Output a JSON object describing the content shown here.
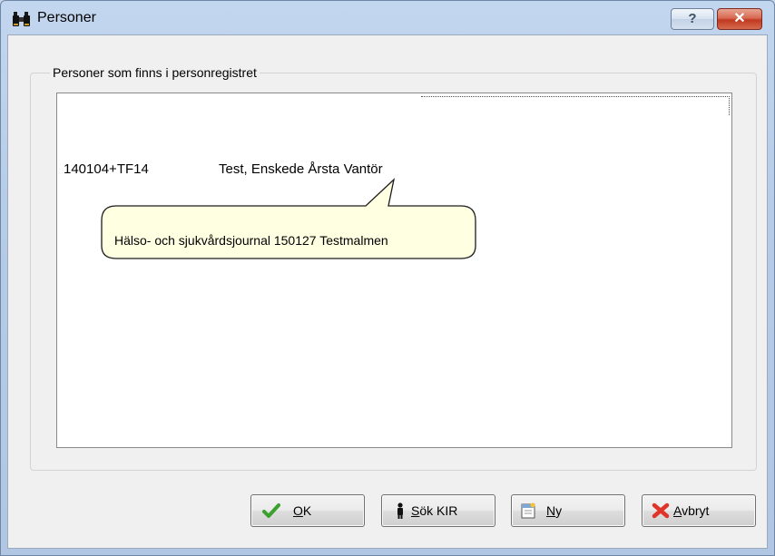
{
  "window": {
    "title": "Personer",
    "help_label": "?",
    "close_label": "✕"
  },
  "group": {
    "legend": "Personer som finns i personregistret"
  },
  "list": {
    "rows": [
      {
        "id": "140104+TF14",
        "name": "Test, Enskede Årsta Vantör"
      }
    ]
  },
  "tooltip": {
    "text": "Hälso- och sjukvårdsjournal 150127 Testmalmen"
  },
  "buttons": {
    "ok": {
      "mnemonic": "O",
      "rest": "K"
    },
    "search": {
      "mnemonic": "S",
      "rest": "ök KIR"
    },
    "new": {
      "mnemonic": "N",
      "rest": "y"
    },
    "cancel": {
      "mnemonic": "A",
      "rest": "vbryt"
    }
  },
  "icons": {
    "app": "binoculars-icon",
    "ok": "checkmark-icon",
    "search": "person-icon",
    "new": "new-document-icon",
    "cancel": "red-x-icon"
  },
  "colors": {
    "tooltip_bg": "#ffffe1",
    "ok_green": "#3aa12e",
    "cancel_red": "#e0342a",
    "close_red": "#c0391f"
  }
}
